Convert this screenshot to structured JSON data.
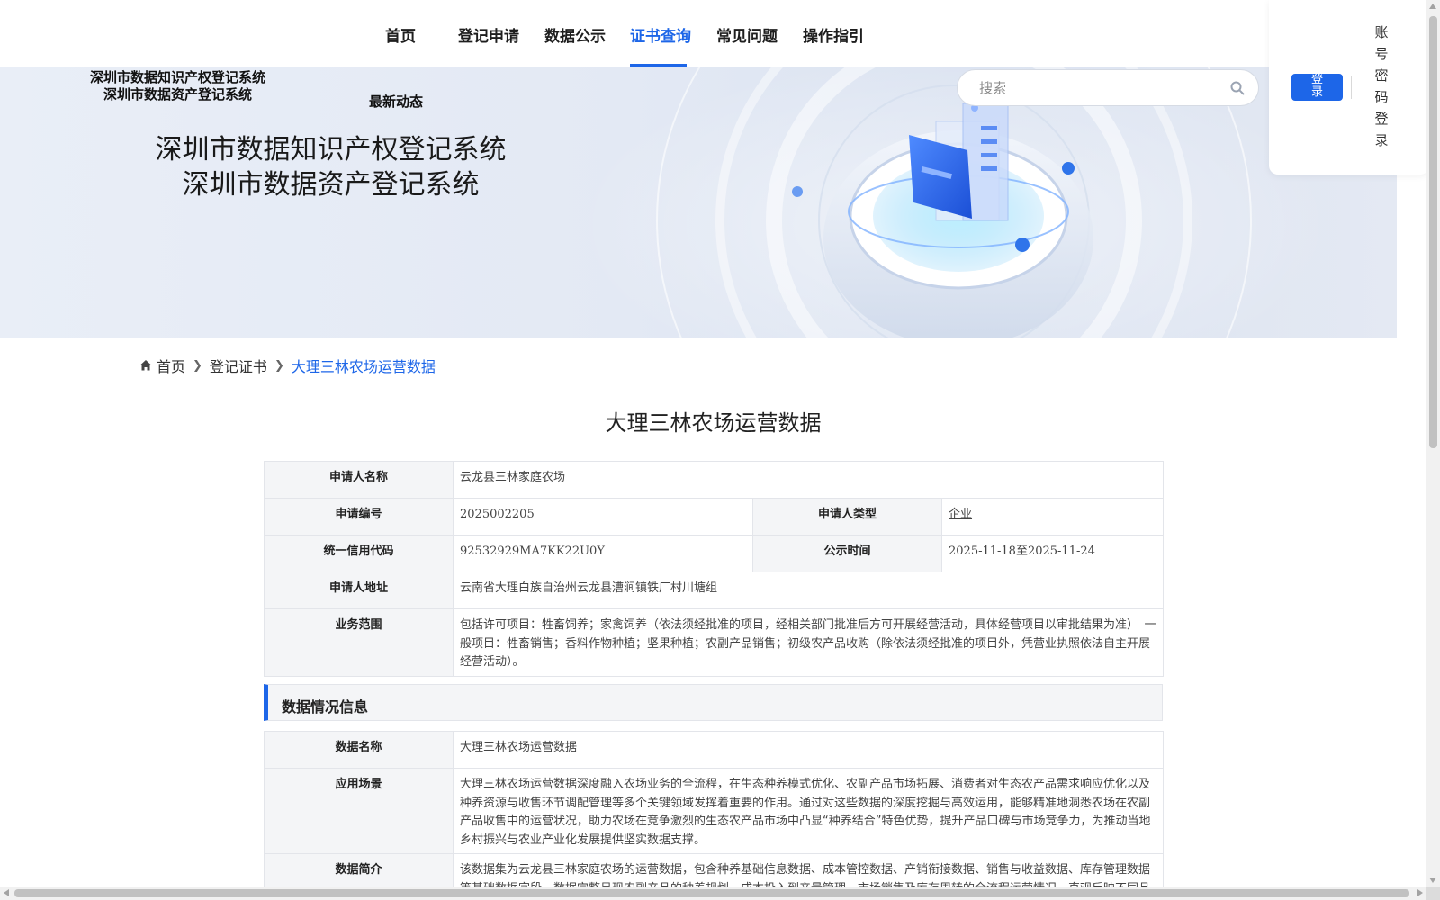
{
  "nav": {
    "items": [
      {
        "label": "首页",
        "active": false
      },
      {
        "label": "登记申请",
        "active": false
      },
      {
        "label": "数据公示",
        "active": false
      },
      {
        "label": "证书查询",
        "active": true
      },
      {
        "label": "常见问题",
        "active": false
      },
      {
        "label": "操作指引",
        "active": false
      }
    ],
    "accent_color": "#1d66e8"
  },
  "banner": {
    "system_name_line1": "深圳市数据知识产权登记系统",
    "system_name_line2": "深圳市数据资产登记系统",
    "latest_news": "最新动态",
    "large_title_line1": "深圳市数据知识产权登记系统",
    "large_title_line2": "深圳市数据资产登记系统"
  },
  "search": {
    "placeholder": "搜索",
    "value": "",
    "icon": "search-icon"
  },
  "login": {
    "button_label": "登录",
    "account_login_label": "账号密码登录"
  },
  "breadcrumb": {
    "home": "首页",
    "level1": "登记证书",
    "current": "大理三林农场运营数据",
    "home_icon": "home-icon"
  },
  "page_title": "大理三林农场运营数据",
  "applicant": {
    "name_label": "申请人名称",
    "name_value": "云龙县三林家庭农场",
    "number_label": "申请编号",
    "number_value": "2025002205",
    "type_label": "申请人类型",
    "type_value": "企业",
    "credit_code_label": "统一信用代码",
    "credit_code_value": "92532929MA7KK22U0Y",
    "publicity_label": "公示时间",
    "publicity_value": "2025-11-18至2025-11-24",
    "address_label": "申请人地址",
    "address_value": "云南省大理白族自治州云龙县漕涧镇铁厂村川塘组",
    "scope_label": "业务范围",
    "scope_value": "包括许可项目：牲畜饲养；家禽饲养（依法须经批准的项目，经相关部门批准后方可开展经营活动，具体经营项目以审批结果为准）　一般项目：牲畜销售；香料作物种植；坚果种植；农副产品销售；初级农产品收购（除依法须经批准的项目外，凭营业执照依法自主开展经营活动）。"
  },
  "data_section": {
    "header": "数据情况信息",
    "name_label": "数据名称",
    "name_value": "大理三林农场运营数据",
    "scenario_label": "应用场景",
    "scenario_value": "大理三林农场运营数据深度融入农场业务的全流程，在生态种养模式优化、农副产品市场拓展、消费者对生态农产品需求响应优化以及种养资源与收售环节调配管理等多个关键领域发挥着重要的作用。通过对这些数据的深度挖掘与高效运用，能够精准地洞悉农场在农副产品收售中的运营状况，助力农场在竞争激烈的生态农产品市场中凸显“种养结合”特色优势，提升产品口碑与市场竞争力，为推动当地乡村振兴与农业产业化发展提供坚实数据支撑。",
    "intro_label": "数据简介",
    "intro_value": "该数据集为云龙县三林家庭农场的运营数据，包含种养基础信息数据、成本管控数据、产销衔接数据、销售与收益数据、库存管理数据等基础数据字段。数据完整呈现农副产品的种养规划、成本投入到产量管理、市场销售及库存周转的全流程运营情况，直观反映不同品类农产品的种养效益、市场需求变化、运营成本与收益关系，为农场优化种养结构、精准匹配市场需求、控制运营成本提供数据依据。"
  }
}
